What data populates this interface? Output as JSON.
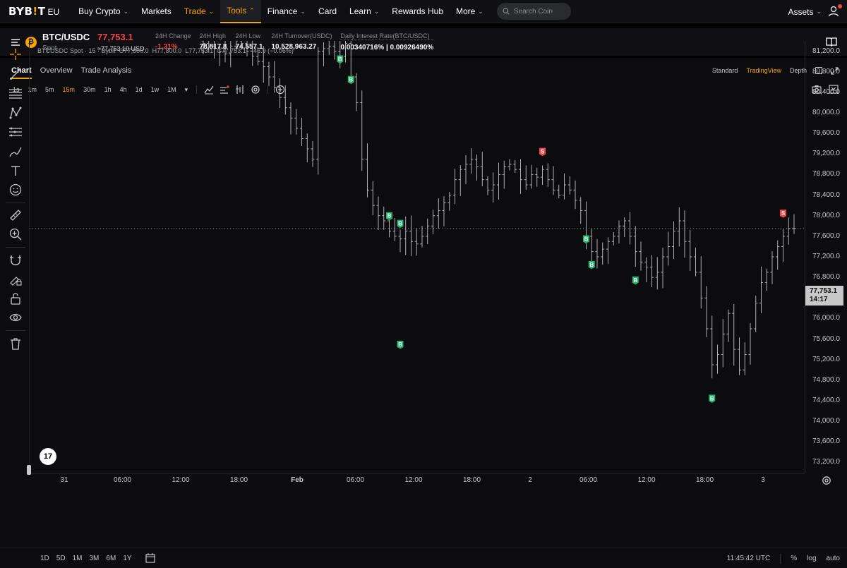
{
  "nav": {
    "logo_text": "BYB",
    "logo_bar": "!",
    "logo_tail": "T",
    "logo_region": "EU",
    "items": [
      {
        "label": "Buy Crypto",
        "chev": "⌄"
      },
      {
        "label": "Markets",
        "chev": ""
      },
      {
        "label": "Trade",
        "chev": "⌄"
      },
      {
        "label": "Tools",
        "chev": "⌃"
      },
      {
        "label": "Finance",
        "chev": "⌄"
      },
      {
        "label": "Card",
        "chev": ""
      },
      {
        "label": "Learn",
        "chev": "⌄"
      },
      {
        "label": "Rewards Hub",
        "chev": ""
      },
      {
        "label": "More",
        "chev": "⌄"
      }
    ],
    "search_placeholder": "Search Coin",
    "assets_label": "Assets",
    "assets_chev": "⌄"
  },
  "ticker": {
    "coin_symbol": "₿",
    "pair": "BTC/USDC",
    "type": "Spot",
    "price": "77,753.1",
    "price_usd": "≈77,753.10 USD",
    "stats": [
      {
        "label": "24H Change",
        "value": "-1.31%"
      },
      {
        "label": "24H High",
        "value": "78,817.8"
      },
      {
        "label": "24H Low",
        "value": "74,557.1"
      },
      {
        "label": "24H Turnover(USDC)",
        "value": "10,528,963.27"
      },
      {
        "label": "Daily Interest Rate(BTC/USDC)",
        "value": "0.00340716% | 0.00926490%"
      }
    ]
  },
  "tabs": [
    "Chart",
    "Overview",
    "Trade Analysis"
  ],
  "view_options": [
    "Standard",
    "TradingView",
    "Depth"
  ],
  "timeframes": [
    "1s",
    "1m",
    "5m",
    "15m",
    "30m",
    "1h",
    "4h",
    "1d",
    "1w",
    "1M"
  ],
  "timeframe_more": "▾",
  "legend": {
    "symbol": "BTCUSDC Spot · 15 · Bybit",
    "o_label": "O",
    "o": "77,800.0",
    "h_label": "H",
    "h": "77,800.0",
    "l_label": "L",
    "l": "77,753.1",
    "c_label": "C",
    "c": "77,753.1",
    "change": "−46.9 (−0.06%)"
  },
  "price_tag": {
    "price": "77,753.1",
    "countdown": "14:17"
  },
  "bottom": {
    "ranges": [
      "1D",
      "5D",
      "1M",
      "3M",
      "6M",
      "1Y"
    ],
    "clock": "11:45:42 UTC",
    "pct": "%",
    "log": "log",
    "auto": "auto"
  },
  "tv_logo": "17",
  "colors": {
    "accent": "#f7a600",
    "down": "#ef454a",
    "buy_marker": "#20b26c",
    "sell_marker": "#ef454a",
    "candle": "#bfc1c6"
  },
  "chart_data": {
    "type": "ohlc",
    "interval": "15m",
    "y_ticks": [
      81200,
      80800,
      80400,
      80000,
      79600,
      79200,
      78800,
      78400,
      78000,
      77600,
      77200,
      76800,
      76400,
      76000,
      75600,
      75200,
      74800,
      74400,
      74000,
      73600,
      73200
    ],
    "y_tick_labels": [
      "81,200.0",
      "80,800.0",
      "80,400.0",
      "80,000.0",
      "79,600.0",
      "79,200.0",
      "78,800.0",
      "78,400.0",
      "78,000.0",
      "77,600.0",
      "77,200.0",
      "76,800.0",
      "76,400.0",
      "76,000.0",
      "75,600.0",
      "75,200.0",
      "74,800.0",
      "74,400.0",
      "74,000.0",
      "73,600.0",
      "73,200.0"
    ],
    "ylim": [
      73000,
      81400
    ],
    "x_ticks": [
      "31",
      "06:00",
      "12:00",
      "18:00",
      "Feb",
      "06:00",
      "12:00",
      "18:00",
      "2",
      "06:00",
      "12:00",
      "18:00",
      "3"
    ],
    "last_price": 77753.1,
    "markers": [
      {
        "side": "B",
        "label": "B",
        "bar": 25,
        "price": 81050
      },
      {
        "side": "B",
        "label": "B",
        "bar": 27,
        "price": 80650
      },
      {
        "side": "B",
        "label": "B",
        "bar": 34,
        "price": 78000
      },
      {
        "side": "B",
        "label": "B",
        "bar": 36,
        "price": 77850
      },
      {
        "side": "B",
        "label": "B",
        "bar": 36,
        "price": 75500
      },
      {
        "side": "S",
        "label": "S",
        "bar": 62,
        "price": 79250
      },
      {
        "side": "B",
        "label": "B",
        "bar": 70,
        "price": 77550
      },
      {
        "side": "B",
        "label": "B",
        "bar": 71,
        "price": 77050
      },
      {
        "side": "B",
        "label": "B",
        "bar": 79,
        "price": 76750
      },
      {
        "side": "B",
        "label": "B",
        "bar": 93,
        "price": 74450
      },
      {
        "side": "S",
        "label": "S",
        "bar": 106,
        "price": 78050
      }
    ],
    "closes": [
      81350,
      81300,
      81250,
      81200,
      81150,
      81300,
      81400,
      81350,
      81200,
      81100,
      81000,
      80900,
      80700,
      80500,
      80300,
      80100,
      79900,
      79700,
      79500,
      79300,
      79100,
      81200,
      81250,
      81300,
      81200,
      81100,
      81350,
      80700,
      80200,
      79100,
      78500,
      78200,
      78000,
      77900,
      77700,
      77600,
      77550,
      77700,
      77500,
      77450,
      77600,
      77800,
      78000,
      78100,
      78250,
      78400,
      78700,
      78900,
      79000,
      79100,
      78950,
      78700,
      78500,
      78600,
      78800,
      78950,
      79000,
      78900,
      78700,
      78600,
      78800,
      78750,
      78900,
      78700,
      78500,
      78400,
      78600,
      78500,
      78300,
      78100,
      77600,
      77300,
      77200,
      77350,
      77500,
      77600,
      77800,
      77900,
      77600,
      77300,
      77100,
      77000,
      76800,
      76900,
      77200,
      77400,
      77700,
      77900,
      77500,
      77200,
      76900,
      76400,
      75800,
      75100,
      75300,
      75700,
      76100,
      75400,
      75000,
      75300,
      75800,
      76300,
      76700,
      76900,
      77200,
      77400,
      77600,
      77750,
      77753.1
    ],
    "source_note": ""
  }
}
